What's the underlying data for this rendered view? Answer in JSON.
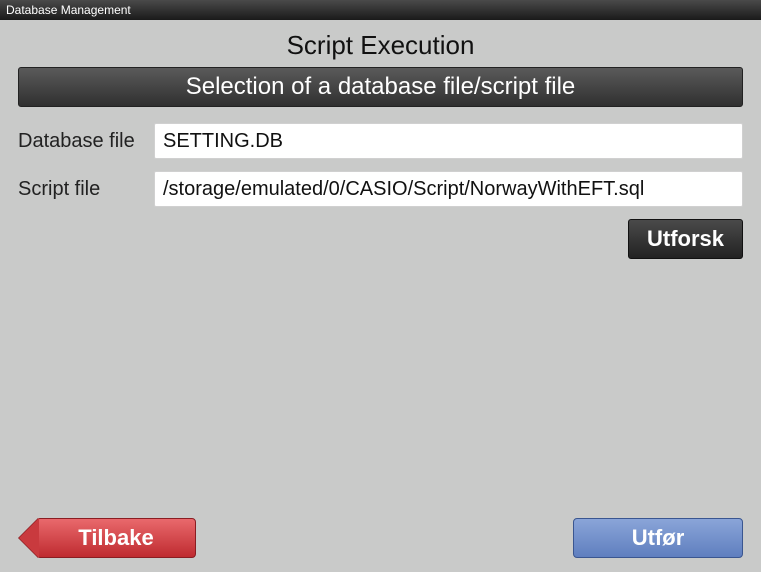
{
  "window": {
    "title": "Database Management"
  },
  "page": {
    "title": "Script Execution",
    "section_header": "Selection of a database file/script file"
  },
  "form": {
    "database_label": "Database file",
    "database_value": "SETTING.DB",
    "script_label": "Script file",
    "script_value": "/storage/emulated/0/CASIO/Script/NorwayWithEFT.sql",
    "browse_button": "Utforsk"
  },
  "footer": {
    "back_button": "Tilbake",
    "execute_button": "Utfør"
  }
}
